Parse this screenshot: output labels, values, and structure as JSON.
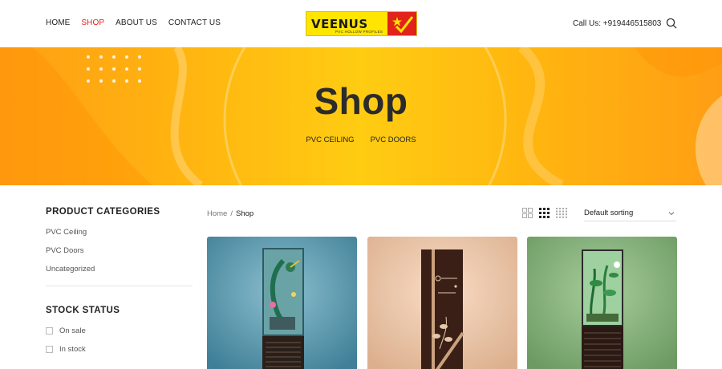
{
  "header": {
    "nav": [
      "HOME",
      "SHOP",
      "ABOUT US",
      "CONTACT US"
    ],
    "active_nav": "SHOP",
    "logo_text": "VEENUS",
    "logo_sub": "PVC HOLLOW PROFILES",
    "call_text": "Call Us: +919446515803",
    "search_icon": "search-icon"
  },
  "hero": {
    "title": "Shop",
    "categories": [
      "PVC CEILING",
      "PVC DOORS"
    ]
  },
  "sidebar": {
    "categories_title": "PRODUCT CATEGORIES",
    "categories": [
      "PVC Ceiling",
      "PVC Doors",
      "Uncategorized"
    ],
    "stock_title": "STOCK STATUS",
    "stock": [
      "On sale",
      "In stock"
    ]
  },
  "main": {
    "breadcrumb": {
      "home": "Home",
      "separator": "/",
      "current": "Shop"
    },
    "view_icons": [
      "grid-2-icon",
      "grid-3-icon",
      "grid-4-icon"
    ],
    "sorting": "Default sorting",
    "products": [
      {
        "image": "peacock-door",
        "background": "#5b96ab"
      },
      {
        "image": "floral-brown-door",
        "background": "#f0cbb0"
      },
      {
        "image": "plant-glass-door",
        "background": "#86b27c"
      }
    ]
  },
  "colors": {
    "accent": "#e2231a",
    "hero_yellow": "#ffcc12",
    "hero_orange": "#ff9e14"
  }
}
